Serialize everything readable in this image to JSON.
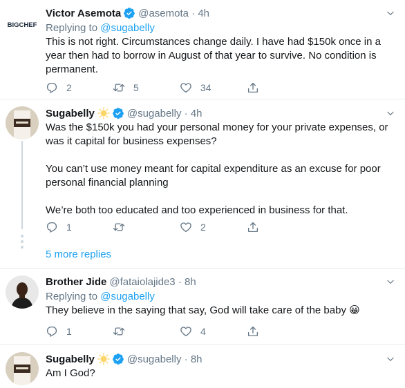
{
  "tweets": [
    {
      "name": "Victor Asemota",
      "handle": "@asemota",
      "time": "4h",
      "avatar_text": "BIGCHEF",
      "replying_prefix": "Replying to",
      "replying_to": "@sugabelly",
      "text": "This is not right. Circumstances change daily. I have had $150k once in a year then had to borrow in August of that year to survive. No condition is permanent.",
      "replies": "2",
      "retweets": "5",
      "likes": "34"
    },
    {
      "name": "Sugabelly",
      "handle": "@sugabelly",
      "time": "4h",
      "text": "Was the $150k you had your personal money for your private expenses, or was it capital for business expenses?\n\nYou can’t use money meant for capital expenditure as an excuse for poor personal financial planning\n\nWe’re both too educated and too experienced in business for that.",
      "replies": "1",
      "retweets": "",
      "likes": "2"
    },
    {
      "name": "Brother Jide",
      "handle": "@fataiolajide3",
      "time": "8h",
      "replying_prefix": "Replying to",
      "replying_to": "@sugabelly",
      "text": "They believe in the saying that say, God will take care of the baby 😀",
      "replies": "1",
      "retweets": "",
      "likes": "4"
    },
    {
      "name": "Sugabelly",
      "handle": "@sugabelly",
      "time": "8h",
      "text": "Am I God?"
    }
  ],
  "more_replies": "5 more replies",
  "colors": {
    "accent": "#1da1f2",
    "secondary": "#657786",
    "divider": "#e6ecf0"
  }
}
